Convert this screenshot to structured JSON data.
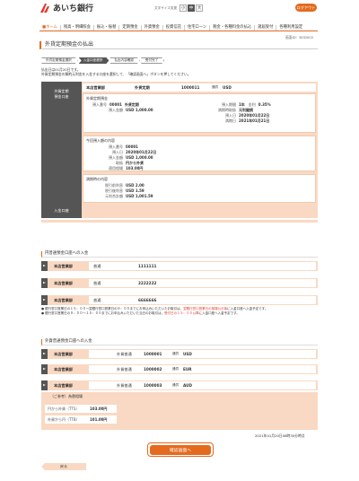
{
  "header": {
    "bank_name": "あいち銀行",
    "font_size_label": "文字サイズ変更",
    "font_sizes": [
      "小",
      "中",
      "大"
    ],
    "logout": "ログアウト"
  },
  "nav": [
    "ホーム",
    "残高・明細照会",
    "振込・振替",
    "定期預金",
    "外貨預金",
    "投資信託",
    "住宅ローン",
    "税金・各種料金の払込",
    "諸届受付",
    "各種利用設定"
  ],
  "screen_id": "画面ID：BOD002",
  "page_title": "外貨定期預金の払出",
  "steps": [
    "外貨定期預金選択",
    "入金口座選択",
    "払出内容確認",
    "受付完了"
  ],
  "intro": {
    "line1": "払出日は01月20日です。",
    "line2": "外貨定期預金の解約元利金を入金する口座を選択して、「確認画面へ」ボタンを押してください。"
  },
  "deposit": {
    "side_label_1": "外貨定期",
    "side_label_2": "預金口座",
    "head": {
      "branch": "本店営業部",
      "type": "外貨定期",
      "number": "1000011",
      "currency_label": "通貨",
      "currency": "USD"
    },
    "section1_title": "外貨定期預金",
    "deposit_no_label": "預入番号",
    "deposit_no": "00001",
    "deposit_no_type": "外貨定期",
    "amount_label": "預入金額",
    "amount": "USD 1,000.00",
    "period_label": "預入期間",
    "period": "1年",
    "rate_label": "金利",
    "rate": "0.35%",
    "method_label": "満期時取扱",
    "method": "元利継続",
    "date_label": "預入日",
    "date": "2020年01月22日",
    "maturity_label": "満期日",
    "maturity": "2021年01月21日",
    "section2_title": "今回預入額の内容",
    "s2_no_label": "預入番号",
    "s2_no": "00001",
    "s2_date_label": "預入日",
    "s2_date": "2020年01月22日",
    "s2_amount_label": "預入金額",
    "s2_amount": "USD 1,000.00",
    "s2_source_label": "取扱",
    "s2_source": "円から外貨",
    "s2_rate_label": "適用相場",
    "s2_rate": "103.00円",
    "section3_title": "満期時の内容",
    "interest_label": "税引前利息",
    "interest": "USD 2.00",
    "tax_label": "税引後利息",
    "tax": "USD 1.59",
    "total_label": "元利合計額",
    "total": "USD 1,001.59"
  },
  "tab_label": "入金口座",
  "yen_section_title": "円普通預金口座への入金",
  "yen_accounts": [
    {
      "branch": "本店営業部",
      "type": "普通",
      "number": "1111111"
    },
    {
      "branch": "本店営業部",
      "type": "普通",
      "number": "2222222"
    },
    {
      "branch": "本店営業部",
      "type": "普通",
      "number": "6666666"
    }
  ],
  "notes": {
    "n1a": "● 銀行窓口営業日の１５：００〜翌銀行窓口営業日の９：００までにお申込みいただいたお取引は、",
    "n1b": "翌銀行窓口営業日の相場公示後",
    "n1c": "に入金口座へ入金予定です。",
    "n2a": "● 銀行窓口営業日の９：００〜１５：００までにお申込みいただいた当日のお取引は、",
    "n2b": "受付日の１５：００以降",
    "n2c": "に入金口座へ入金予定です。"
  },
  "fx_section_title": "外貨普通預金口座への入金",
  "fx_accounts": [
    {
      "branch": "本店営業部",
      "type": "外貨普通",
      "number": "1000001",
      "currency_label": "通貨",
      "currency": "USD"
    },
    {
      "branch": "本店営業部",
      "type": "外貨普通",
      "number": "1000002",
      "currency_label": "通貨",
      "currency": "EUR"
    },
    {
      "branch": "本店営業部",
      "type": "外貨普通",
      "number": "1000003",
      "currency_label": "通貨",
      "currency": "AUD"
    }
  ],
  "reference": {
    "title": "（ご参考）為替相場",
    "rows": [
      {
        "label": "円から外貨（TTS）",
        "value": "103.00円"
      },
      {
        "label": "外貨から円（TTB）",
        "value": "101.00円"
      }
    ]
  },
  "timestamp": "2021年01月20日08時30分時点",
  "confirm_button": "確認画面へ",
  "back_button": "戻る",
  "colors": {
    "accent": "#e46a1e",
    "panel": "#f9d9c3",
    "dark": "#555555"
  }
}
